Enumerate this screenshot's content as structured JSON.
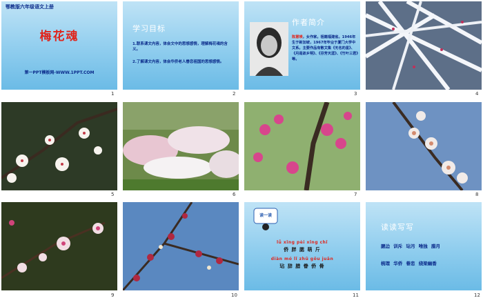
{
  "slides": [
    {
      "num": "1",
      "header": "鄂教版六年级语文上册",
      "title": "梅花魂",
      "website": "第一PPT模板网-WWW.1PPT.COM"
    },
    {
      "num": "2",
      "title": "学习目标",
      "p1": "1.联系课文内容，体会文中的思想感情，理解梅花魂的含义。",
      "p2": "2.了解课文内容，体会华侨老人眷恋祖国的思想感情。"
    },
    {
      "num": "3",
      "title": "作者简介",
      "author": "陈慧瑛",
      "bio": "，女作家。祖籍福建省。1946年生于新加坡，1967年毕业于厦门大学中文系。主要作品有散文集《无名的星》、《月是故乡明》、《芬芳天涯》、《竹叶三君》等。"
    },
    {
      "num": "4"
    },
    {
      "num": "5"
    },
    {
      "num": "6"
    },
    {
      "num": "7"
    },
    {
      "num": "8"
    },
    {
      "num": "9"
    },
    {
      "num": "10"
    },
    {
      "num": "11",
      "badge": "读一读",
      "pinyin1": "lǚ  xǐng  pèi  xǐng  chǐ",
      "hanzi1": "侨  胖  腮  萌  斤",
      "pinyin2": "diàn  mó  lǐ  zhū  gōu  juān",
      "hanzi2": "玷  辞  腊  眷  侨  骨"
    },
    {
      "num": "12",
      "title": "读读写写",
      "row1": "腮边  训斥  玷污  唯独  腊月",
      "row2": "梳理  华侨  眷恋  绕梁幽香"
    }
  ]
}
